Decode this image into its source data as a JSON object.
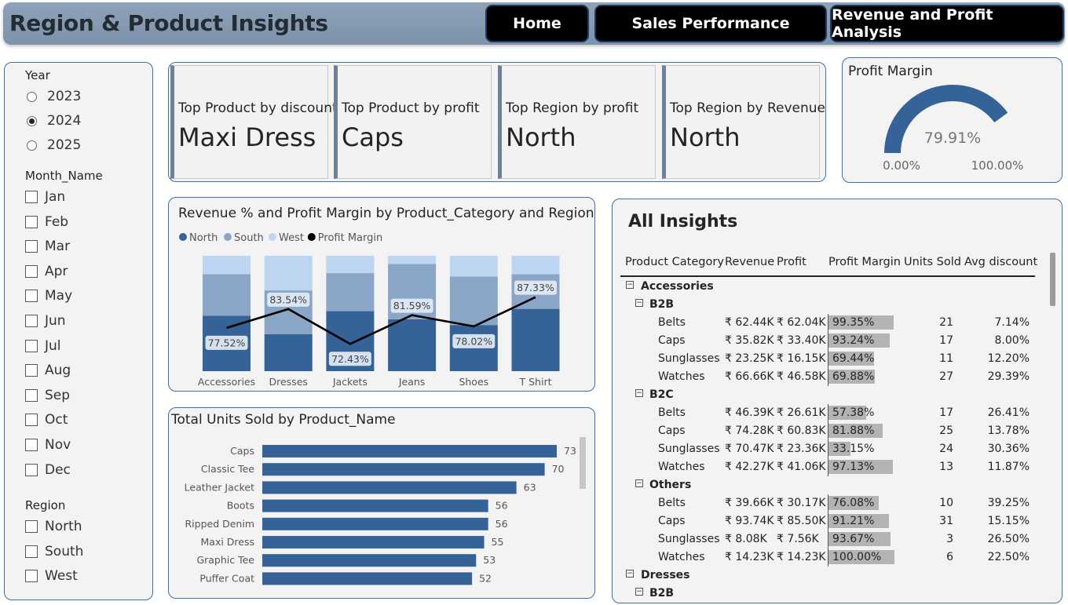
{
  "header": {
    "title": "Region & Product Insights",
    "nav": [
      "Home",
      "Sales Performance",
      "Revenue and Profit Analysis"
    ]
  },
  "filters": {
    "year_title": "Year",
    "years": [
      "2023",
      "2024",
      "2025"
    ],
    "year_selected": "2024",
    "month_title": "Month_Name",
    "months": [
      "Jan",
      "Feb",
      "Mar",
      "Apr",
      "May",
      "Jun",
      "Jul",
      "Aug",
      "Sep",
      "Oct",
      "Nov",
      "Dec"
    ],
    "region_title": "Region",
    "regions": [
      "North",
      "South",
      "West"
    ]
  },
  "kpis": [
    {
      "label": "Top Product by discount",
      "value": "Maxi Dress"
    },
    {
      "label": "Top Product by profit",
      "value": "Caps"
    },
    {
      "label": "Top Region by profit",
      "value": "North"
    },
    {
      "label": "Top Region by Revenue",
      "value": "North"
    }
  ],
  "gauge": {
    "title": "Profit Margin",
    "value_label": "79.91%",
    "value": 0.7991,
    "min_label": "0.00%",
    "max_label": "100.00%",
    "color": "#356397"
  },
  "chart_data": [
    {
      "type": "bar",
      "stacked": true,
      "title": "Revenue % and Profit Margin by Product_Category and Region",
      "categories": [
        "Accessories",
        "Dresses",
        "Jackets",
        "Jeans",
        "Shoes",
        "T Shirt"
      ],
      "series": [
        {
          "name": "North",
          "color": "#356397",
          "values": [
            48,
            32,
            52,
            45,
            40,
            54
          ]
        },
        {
          "name": "South",
          "color": "#8aa6c6",
          "values": [
            36,
            38,
            33,
            48,
            42,
            30
          ]
        },
        {
          "name": "West",
          "color": "#bdd5f0",
          "values": [
            16,
            30,
            15,
            7,
            18,
            16
          ]
        }
      ],
      "line": {
        "name": "Profit Margin",
        "color": "#000000",
        "values": [
          77.52,
          83.54,
          72.43,
          81.59,
          78.02,
          87.33
        ],
        "labels": [
          "77.52%",
          "83.54%",
          "72.43%",
          "81.59%",
          "78.02%",
          "87.33%"
        ]
      },
      "ylim": [
        0,
        100
      ],
      "legend": "top-left"
    },
    {
      "type": "bar",
      "orientation": "horizontal",
      "title": "Total Units Sold by Product_Name",
      "categories": [
        "Caps",
        "Classic Tee",
        "Leather Jacket",
        "Boots",
        "Ripped Denim",
        "Maxi Dress",
        "Graphic Tee",
        "Puffer Coat"
      ],
      "values": [
        73,
        70,
        63,
        56,
        56,
        55,
        53,
        52
      ],
      "color": "#356397",
      "xlim": [
        0,
        80
      ]
    }
  ],
  "insights": {
    "title": "All Insights",
    "columns": [
      "Product Category",
      "Revenue",
      "Profit",
      "Profit Margin",
      "Units Sold",
      "Avg discount"
    ],
    "groups": [
      {
        "name": "Accessories",
        "segments": [
          {
            "name": "B2B",
            "rows": [
              [
                "Belts",
                "₹ 62.44K",
                "₹ 62.04K",
                "99.35%",
                "21",
                "7.14%"
              ],
              [
                "Caps",
                "₹ 35.82K",
                "₹ 33.40K",
                "93.24%",
                "17",
                "8.00%"
              ],
              [
                "Sunglasses",
                "₹ 23.25K",
                "₹ 16.15K",
                "69.44%",
                "11",
                "12.20%"
              ],
              [
                "Watches",
                "₹ 66.66K",
                "₹ 46.58K",
                "69.88%",
                "27",
                "29.39%"
              ]
            ]
          },
          {
            "name": "B2C",
            "rows": [
              [
                "Belts",
                "₹ 46.39K",
                "₹ 26.61K",
                "57.38%",
                "17",
                "26.41%"
              ],
              [
                "Caps",
                "₹ 74.28K",
                "₹ 60.83K",
                "81.88%",
                "25",
                "13.78%"
              ],
              [
                "Sunglasses",
                "₹ 70.47K",
                "₹ 23.36K",
                "33.15%",
                "24",
                "30.36%"
              ],
              [
                "Watches",
                "₹ 42.27K",
                "₹ 41.06K",
                "97.13%",
                "13",
                "11.87%"
              ]
            ]
          },
          {
            "name": "Others",
            "rows": [
              [
                "Belts",
                "₹ 39.66K",
                "₹ 30.17K",
                "76.08%",
                "10",
                "39.25%"
              ],
              [
                "Caps",
                "₹ 93.74K",
                "₹ 85.50K",
                "91.21%",
                "31",
                "15.15%"
              ],
              [
                "Sunglasses",
                "₹ 8.08K",
                "₹ 7.56K",
                "93.67%",
                "3",
                "26.50%"
              ],
              [
                "Watches",
                "₹ 14.23K",
                "₹ 14.23K",
                "100.00%",
                "6",
                "22.50%"
              ]
            ]
          }
        ]
      },
      {
        "name": "Dresses",
        "segments": [
          {
            "name": "B2B",
            "rows": []
          }
        ]
      }
    ]
  }
}
